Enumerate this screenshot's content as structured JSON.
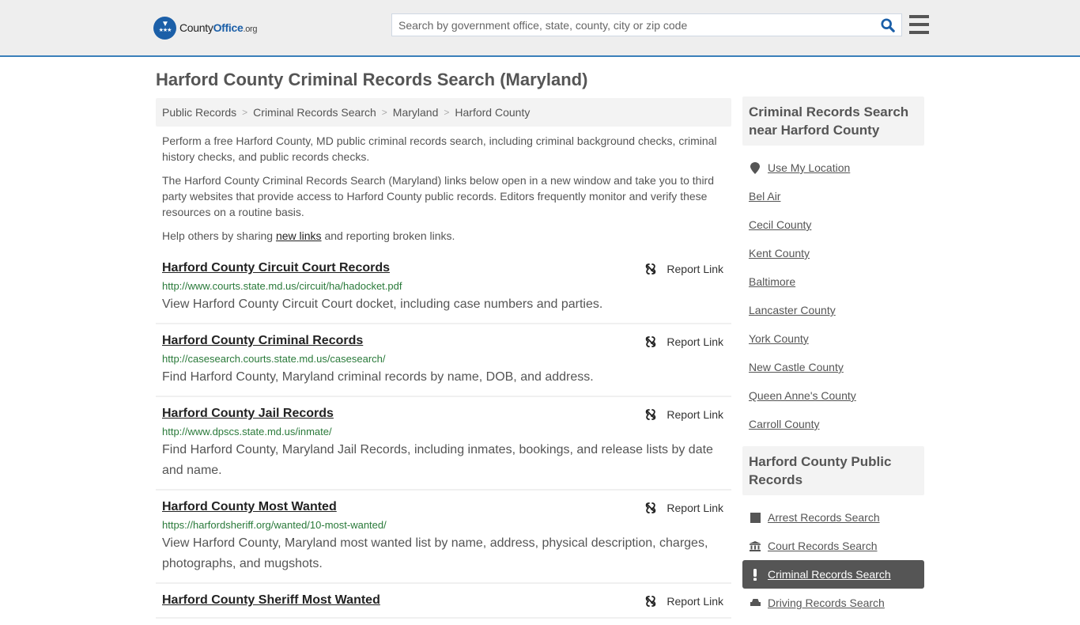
{
  "header": {
    "logo": {
      "name_part1": "County",
      "name_part2": "Office",
      "name_part3": ".org"
    },
    "search": {
      "placeholder": "Search by government office, state, county, city or zip code",
      "value": ""
    },
    "colors": {
      "brand": "#1b5fa8",
      "accent_border": "#3a7fba"
    }
  },
  "page": {
    "title": "Harford County Criminal Records Search (Maryland)"
  },
  "breadcrumb": [
    {
      "label": "Public Records"
    },
    {
      "label": "Criminal Records Search"
    },
    {
      "label": "Maryland"
    },
    {
      "label": "Harford County"
    }
  ],
  "intro": {
    "p1": "Perform a free Harford County, MD public criminal records search, including criminal background checks, criminal history checks, and public records checks.",
    "p2": "The Harford County Criminal Records Search (Maryland) links below open in a new window and take you to third party websites that provide access to Harford County public records. Editors frequently monitor and verify these resources on a routine basis.",
    "p3_before": "Help others by sharing ",
    "p3_link": "new links",
    "p3_after": " and reporting broken links."
  },
  "listings": [
    {
      "title": "Harford County Circuit Court Records",
      "url": "http://www.courts.state.md.us/circuit/ha/hadocket.pdf",
      "desc": "View Harford County Circuit Court docket, including case numbers and parties.",
      "report": "Report Link"
    },
    {
      "title": "Harford County Criminal Records",
      "url": "http://casesearch.courts.state.md.us/casesearch/",
      "desc": "Find Harford County, Maryland criminal records by name, DOB, and address.",
      "report": "Report Link"
    },
    {
      "title": "Harford County Jail Records",
      "url": "http://www.dpscs.state.md.us/inmate/",
      "desc": "Find Harford County, Maryland Jail Records, including inmates, bookings, and release lists by date and name.",
      "report": "Report Link"
    },
    {
      "title": "Harford County Most Wanted",
      "url": "https://harfordsheriff.org/wanted/10-most-wanted/",
      "desc": "View Harford County, Maryland most wanted list by name, address, physical description, charges, photographs, and mugshots.",
      "report": "Report Link"
    },
    {
      "title": "Harford County Sheriff Most Wanted",
      "url": "",
      "desc": "",
      "report": "Report Link"
    }
  ],
  "sidebar": {
    "nearby_heading": "Criminal Records Search near Harford County",
    "use_location": "Use My Location",
    "nearby": [
      {
        "label": "Bel Air"
      },
      {
        "label": "Cecil County"
      },
      {
        "label": "Kent County"
      },
      {
        "label": "Baltimore"
      },
      {
        "label": "Lancaster County"
      },
      {
        "label": "York County"
      },
      {
        "label": "New Castle County"
      },
      {
        "label": "Queen Anne's County"
      },
      {
        "label": "Carroll County"
      }
    ],
    "public_heading": "Harford County Public Records",
    "public": [
      {
        "label": "Arrest Records Search",
        "icon": "square-icon",
        "active": false
      },
      {
        "label": "Court Records Search",
        "icon": "courthouse-icon",
        "active": false
      },
      {
        "label": "Criminal Records Search",
        "icon": "exclamation-icon",
        "active": true
      },
      {
        "label": "Driving Records Search",
        "icon": "car-icon",
        "active": false
      }
    ]
  }
}
